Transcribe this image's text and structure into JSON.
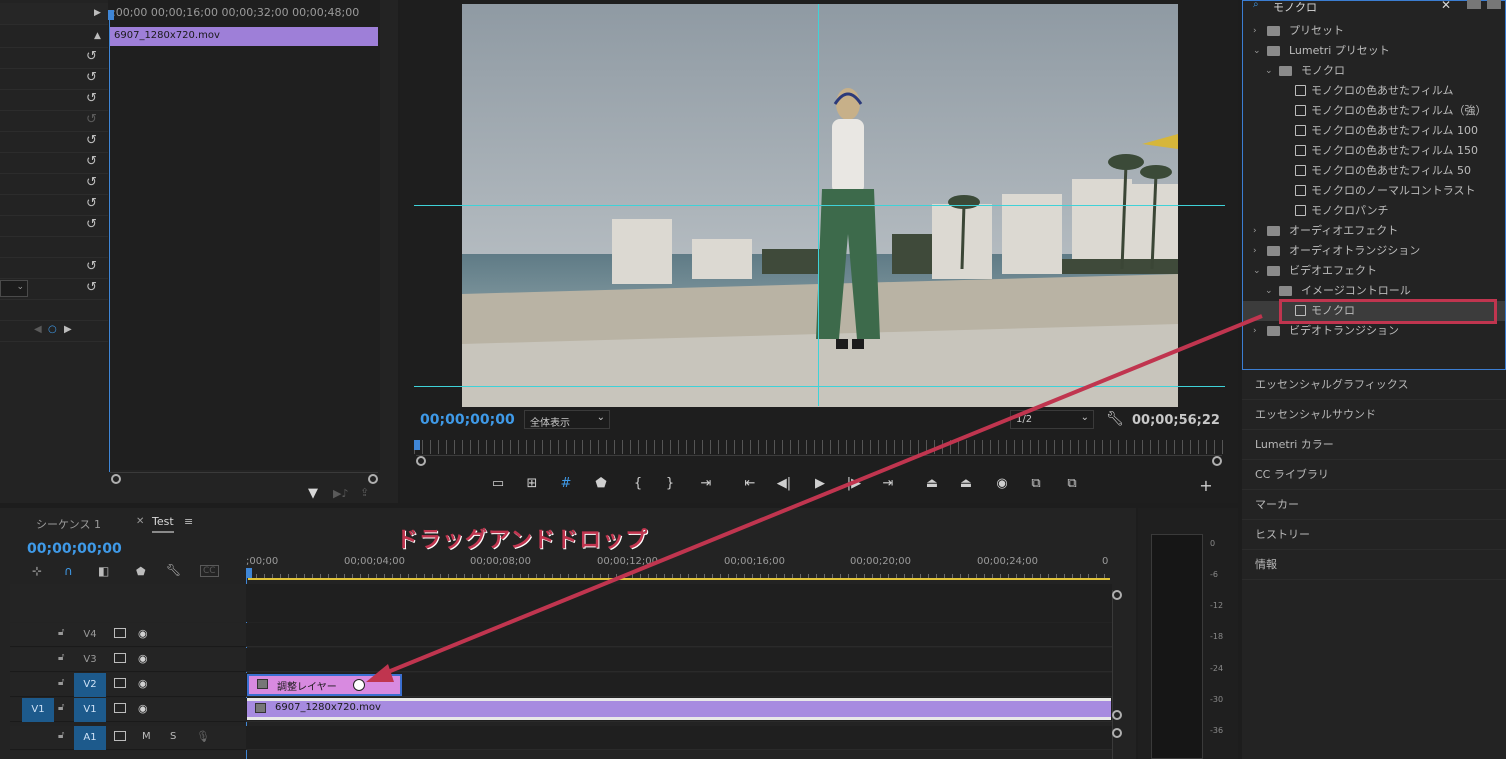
{
  "effect_controls": {
    "ruler_label": ":00;00  00;00;16;00  00;00;32;00  00;00;48;00",
    "clip_name": "6907_1280x720.mov"
  },
  "program_monitor": {
    "timecode_current": "00;00;00;00",
    "zoom_select": "全体表示",
    "quality_select": "1/2",
    "timecode_duration": "00;00;56;22"
  },
  "effects_panel": {
    "search_value": "モノクロ",
    "items": [
      {
        "label": "プリセット"
      },
      {
        "label": "Lumetri プリセット"
      },
      {
        "label": "モノクロ"
      },
      {
        "label": "モノクロの色あせたフィルム"
      },
      {
        "label": "モノクロの色あせたフィルム（強）"
      },
      {
        "label": "モノクロの色あせたフィルム 100"
      },
      {
        "label": "モノクロの色あせたフィルム 150"
      },
      {
        "label": "モノクロの色あせたフィルム 50"
      },
      {
        "label": "モノクロのノーマルコントラスト"
      },
      {
        "label": "モノクロパンチ"
      },
      {
        "label": "オーディオエフェクト"
      },
      {
        "label": "オーディオトランジション"
      },
      {
        "label": "ビデオエフェクト"
      },
      {
        "label": "イメージコントロール"
      },
      {
        "label": "モノクロ"
      },
      {
        "label": "ビデオトランジション"
      }
    ]
  },
  "right_panels": [
    "エッセンシャルグラフィックス",
    "エッセンシャルサウンド",
    "Lumetri カラー",
    "CC ライブラリ",
    "マーカー",
    "ヒストリー",
    "情報"
  ],
  "timeline": {
    "tab_inactive": "シーケンス 1",
    "tab_active": "Test",
    "timecode": "00;00;00;00",
    "annotation": "ドラッグアンドドロップ",
    "ticks": [
      ";00;00",
      "00;00;04;00",
      "00;00;08;00",
      "00;00;12;00",
      "00;00;16;00",
      "00;00;20;00",
      "00;00;24;00",
      "0"
    ],
    "tracks": [
      {
        "name": "V4",
        "src": ""
      },
      {
        "name": "V3",
        "src": ""
      },
      {
        "name": "V2",
        "src": ""
      },
      {
        "name": "V1",
        "src": "V1"
      },
      {
        "name": "A1",
        "src": ""
      }
    ],
    "audio_m": "M",
    "audio_s": "S",
    "clip_adjustment": "調整レイヤー",
    "clip_video": "6907_1280x720.mov"
  },
  "meter": {
    "labels": [
      "0",
      "-6",
      "-12",
      "-18",
      "-24",
      "-30",
      "-36"
    ]
  },
  "colors": {
    "accent_blue": "#3f9ae8",
    "clip_purple": "#9e7fd8",
    "adjustment_pink": "#d88ae0",
    "annotation_red": "#c0354f",
    "guide_cyan": "#3fd2d8"
  }
}
